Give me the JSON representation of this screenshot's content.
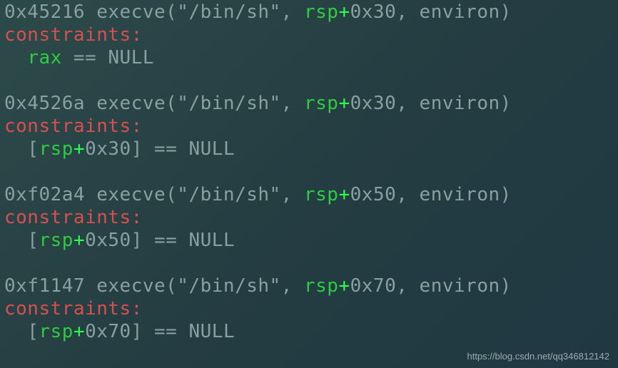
{
  "gadgets": [
    {
      "addr": "0x45216",
      "call_prefix": " execve(\"/bin/sh\", ",
      "reg": "rsp",
      "offset": "0x30",
      "call_suffix": ", environ)",
      "constraints_label": "constraints:",
      "cond": {
        "prefix_brk": "",
        "indent": "  ",
        "open_bracket": "",
        "reg": "rax",
        "plus": "",
        "offset": "",
        "close_bracket": "",
        "eq_null": " == NULL"
      }
    },
    {
      "addr": "0x4526a",
      "call_prefix": " execve(\"/bin/sh\", ",
      "reg": "rsp",
      "offset": "0x30",
      "call_suffix": ", environ)",
      "constraints_label": "constraints:",
      "cond": {
        "indent": "  ",
        "open_bracket": "[",
        "reg": "rsp",
        "plus": "+",
        "offset": "0x30",
        "close_bracket": "]",
        "eq_null": " == NULL"
      }
    },
    {
      "addr": "0xf02a4",
      "call_prefix": " execve(\"/bin/sh\", ",
      "reg": "rsp",
      "offset": "0x50",
      "call_suffix": ", environ)",
      "constraints_label": "constraints:",
      "cond": {
        "indent": "  ",
        "open_bracket": "[",
        "reg": "rsp",
        "plus": "+",
        "offset": "0x50",
        "close_bracket": "]",
        "eq_null": " == NULL"
      }
    },
    {
      "addr": "0xf1147",
      "call_prefix": " execve(\"/bin/sh\", ",
      "reg": "rsp",
      "offset": "0x70",
      "call_suffix": ", environ)",
      "constraints_label": "constraints:",
      "cond": {
        "indent": "  ",
        "open_bracket": "[",
        "reg": "rsp",
        "plus": "+",
        "offset": "0x70",
        "close_bracket": "]",
        "eq_null": " == NULL"
      }
    }
  ],
  "watermark": "https://blog.csdn.net/qq346812142"
}
